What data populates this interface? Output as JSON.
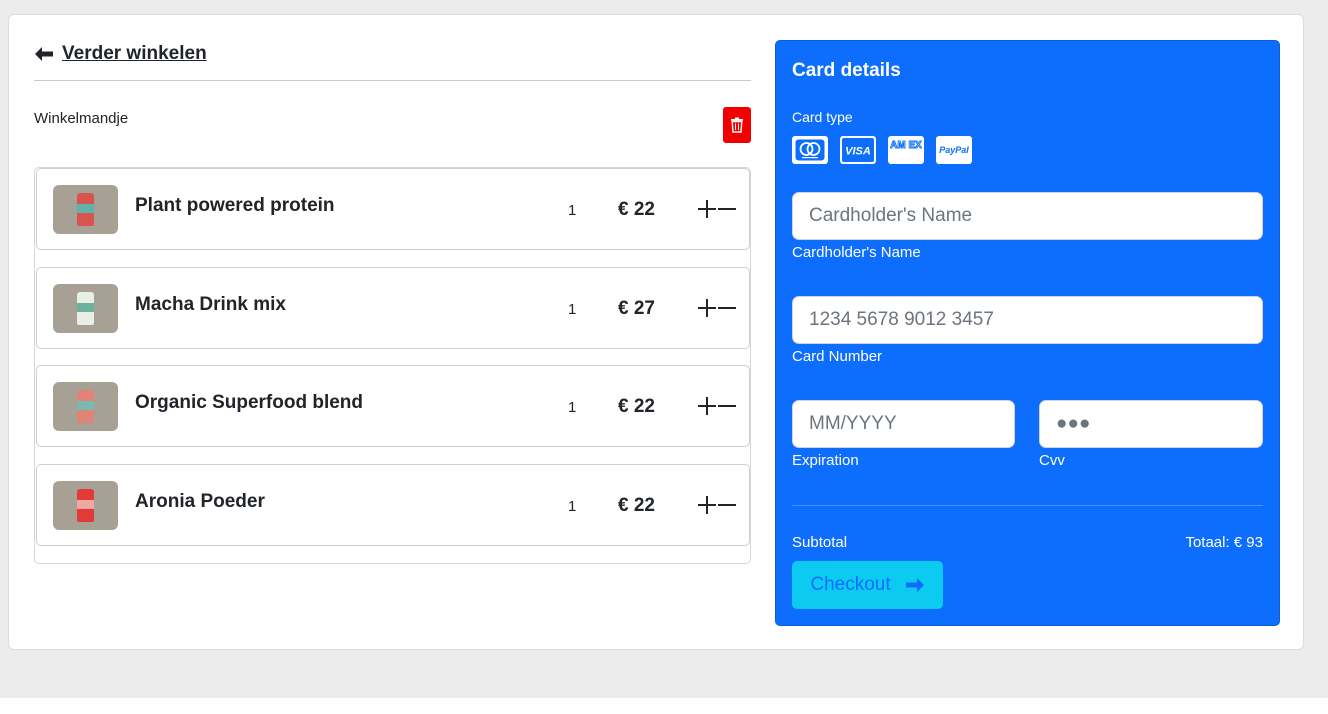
{
  "header": {
    "back_link": "Verder winkelen"
  },
  "cart": {
    "title": "Winkelmandje",
    "items": [
      {
        "name": "Plant powered protein",
        "qty": "1",
        "price": "€ 22",
        "pack_color": "#d9534f",
        "band_color": "#5fb3a8"
      },
      {
        "name": "Macha Drink mix",
        "qty": "1",
        "price": "€ 27",
        "pack_color": "#e9eee7",
        "band_color": "#6bb39a"
      },
      {
        "name": "Organic Superfood blend",
        "qty": "1",
        "price": "€ 22",
        "pack_color": "#e0847a",
        "band_color": "#79b9b0"
      },
      {
        "name": "Aronia Poeder",
        "qty": "1",
        "price": "€ 22",
        "pack_color": "#e23a36",
        "band_color": "#f0a9a0"
      }
    ],
    "plus_symbol": "+",
    "minus_symbol": "−"
  },
  "payment": {
    "title": "Card details",
    "card_type_label": "Card type",
    "card_logos": [
      "mastercard-icon",
      "visa-icon",
      "amex-icon",
      "paypal-icon"
    ],
    "visa_text": "VISA",
    "amex_text": "AM EX",
    "paypal_text": "PayPal",
    "name_placeholder": "Cardholder's Name",
    "name_label": "Cardholder's Name",
    "number_placeholder": "1234 5678 9012 3457",
    "number_label": "Card Number",
    "expiration_placeholder": "MM/YYYY",
    "expiration_label": "Expiration",
    "cvv_placeholder": "●●●",
    "cvv_label": "Cvv",
    "subtotal_label": "Subtotal",
    "total_label": "Totaal: € 93",
    "checkout_label": "Checkout"
  },
  "colors": {
    "primary": "#0d6efd",
    "info": "#0dcaf0",
    "danger": "#f20000"
  }
}
